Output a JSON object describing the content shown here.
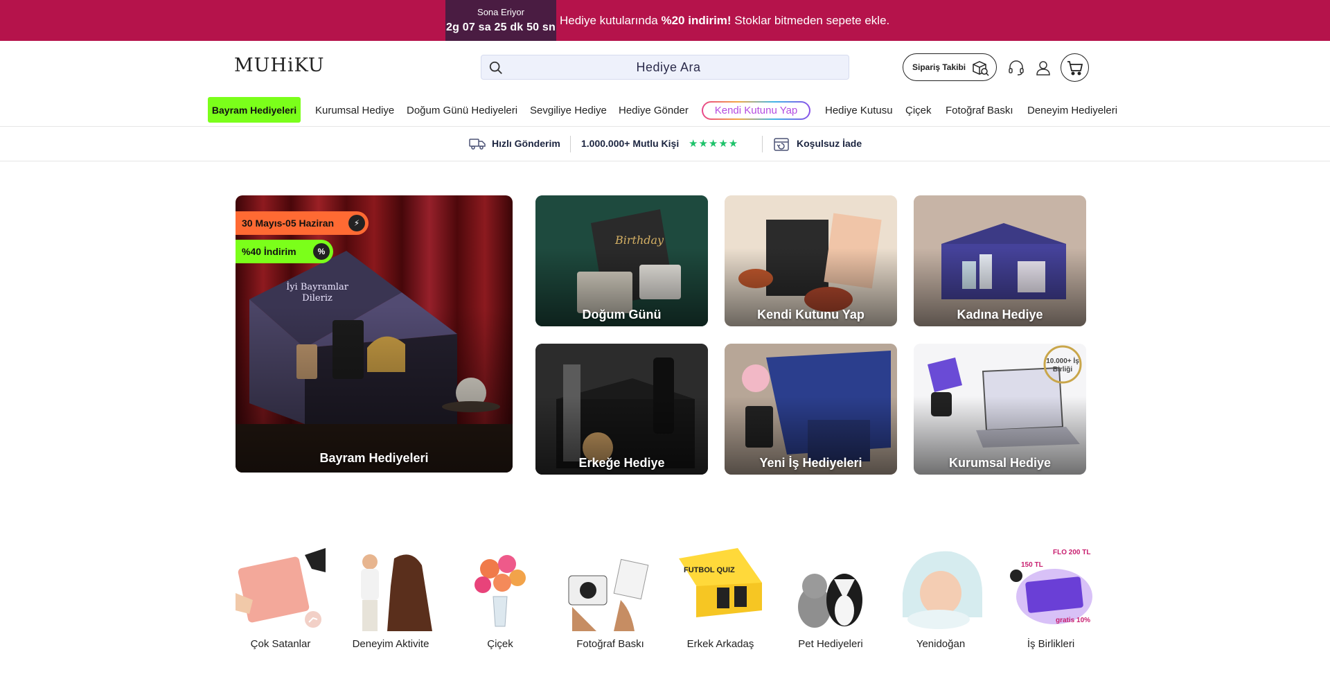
{
  "promo": {
    "countdown_label": "Sona Eriyor",
    "countdown": {
      "days": "2",
      "days_unit": "g",
      "hours": "07",
      "hours_unit": "sa",
      "minutes": "25",
      "minutes_unit": "dk",
      "seconds": "50",
      "seconds_unit": "sn"
    },
    "text_before": "Hediye kutularında ",
    "text_bold": "%20 indirim!",
    "text_after": " Stoklar bitmeden sepete ekle.",
    "bg_color": "#b5134b"
  },
  "header": {
    "logo": "MUHiKU",
    "search_placeholder": "Hediye Ara",
    "order_tracking_label": "Sipariş Takibi"
  },
  "nav": {
    "items": [
      "Bayram Hediyeleri",
      "Kurumsal Hediye",
      "Doğum Günü Hediyeleri",
      "Sevgiliye Hediye",
      "Hediye Gönder",
      "Kendi Kutunu Yap",
      "Hediye Kutusu",
      "Çiçek",
      "Fotoğraf Baskı",
      "Deneyim Hediyeleri"
    ],
    "highlight_color": "#7bff1a"
  },
  "trust": {
    "shipping": "Hızlı Gönderim",
    "customers": "1.000.000+ Mutlu Kişi",
    "stars": "★★★★★",
    "returns": "Koşulsuz İade"
  },
  "hero": {
    "main_tile": {
      "label": "Bayram Hediyeleri",
      "badge_dates": "30 Mayıs-05 Haziran",
      "badge_discount": "%40 İndirim",
      "box_text": "İyi Bayramlar Dileriz"
    },
    "tiles": [
      "Doğum Günü",
      "Kendi Kutunu Yap",
      "Kadına Hediye",
      "Erkeğe Hediye",
      "Yeni İş Hediyeleri",
      "Kurumsal Hediye"
    ],
    "corporate_badge": "10.000+ İş Birliği"
  },
  "categories": [
    "Çok Satanlar",
    "Deneyim Aktivite",
    "Çiçek",
    "Fotoğraf Baskı",
    "Erkek Arkadaş",
    "Pet Hediyeleri",
    "Yenidoğan",
    "İş Birlikleri"
  ],
  "category_art_text": {
    "quiz": "FUTBOL QUIZ",
    "flo": "FLO 200 TL",
    "tl150": "150 TL",
    "gratis": "gratis 10%"
  },
  "icons": [
    "search-icon",
    "package-search-icon",
    "headset-icon",
    "user-icon",
    "cart-icon",
    "truck-icon",
    "return-box-icon",
    "clock-flame-icon",
    "percent-flame-icon",
    "trend-icon"
  ]
}
